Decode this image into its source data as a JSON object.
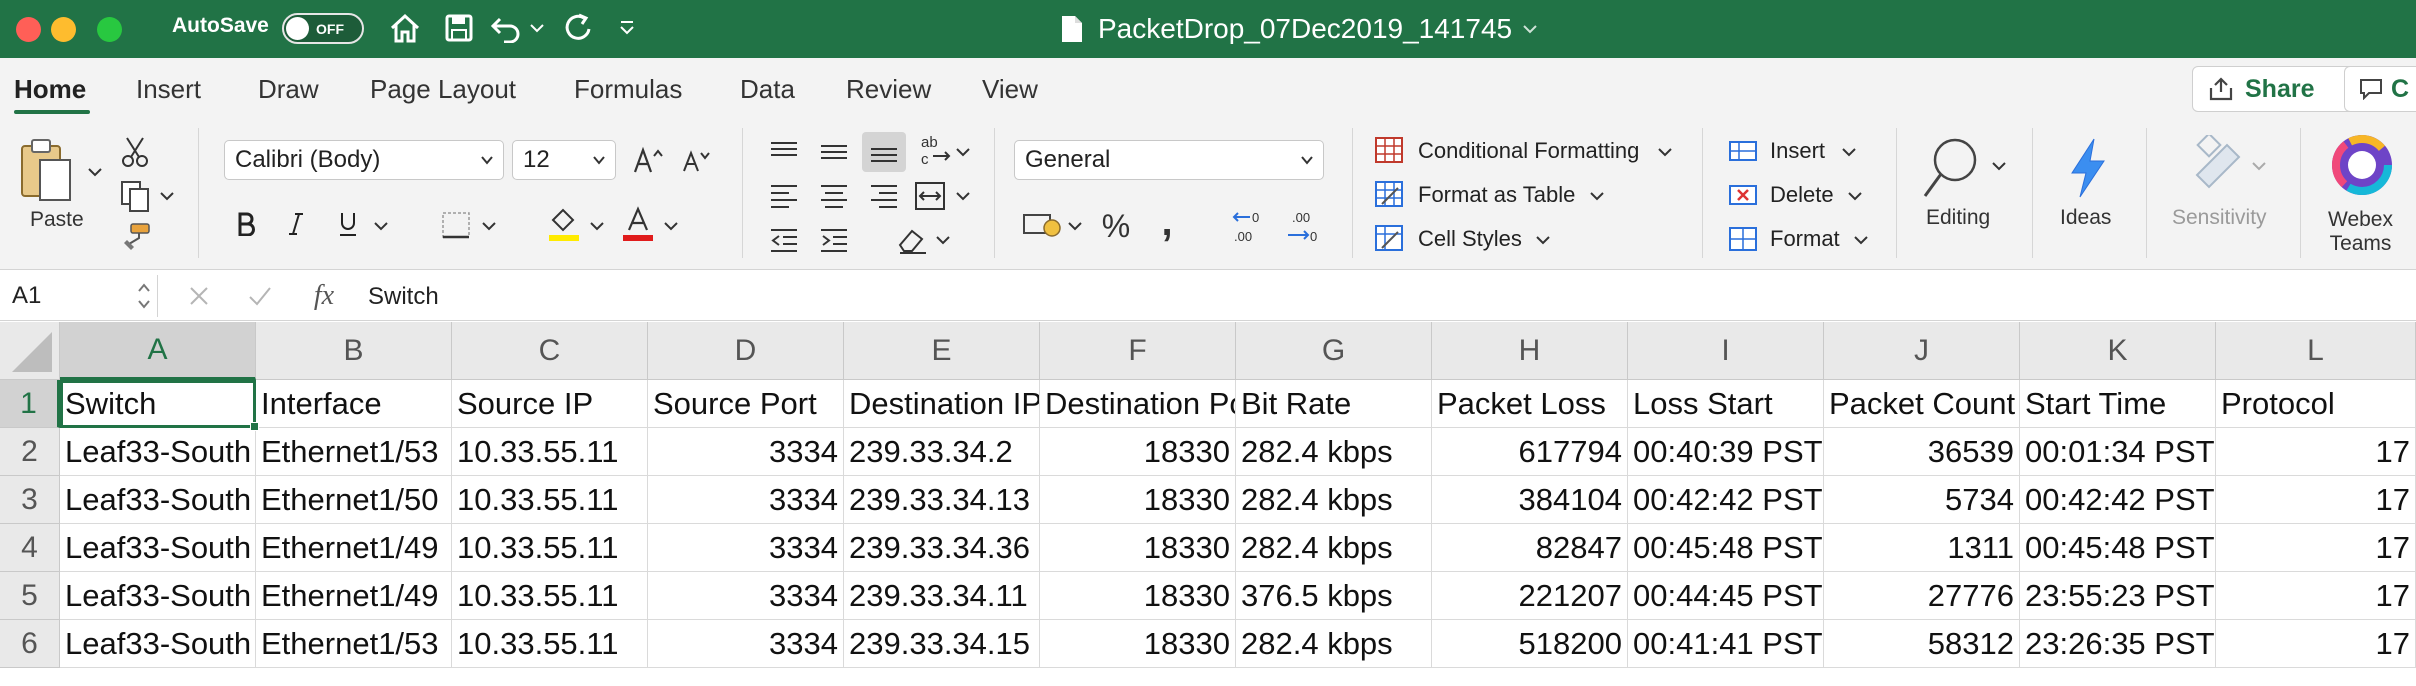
{
  "titlebar": {
    "autosave_label": "AutoSave",
    "toggle_state": "OFF",
    "document_title": "PacketDrop_07Dec2019_141745"
  },
  "tabs": [
    "Home",
    "Insert",
    "Draw",
    "Page Layout",
    "Formulas",
    "Data",
    "Review",
    "View"
  ],
  "share": {
    "label": "Share",
    "partial_label": "C"
  },
  "ribbon": {
    "paste_label": "Paste",
    "font_name": "Calibri (Body)",
    "font_size": "12",
    "number_format": "General",
    "styles": {
      "conditional_formatting": "Conditional Formatting",
      "format_as_table": "Format as Table",
      "cell_styles": "Cell Styles"
    },
    "cells": {
      "insert": "Insert",
      "delete": "Delete",
      "format": "Format"
    },
    "editing_label": "Editing",
    "ideas_label": "Ideas",
    "sensitivity_label": "Sensitivity",
    "webex_line1": "Webex",
    "webex_line2": "Teams",
    "percent_glyph": "%",
    "comma_glyph": ","
  },
  "formula_bar": {
    "name_box": "A1",
    "fx": "fx",
    "value": "Switch"
  },
  "grid": {
    "selected_cell": "A1",
    "columns": [
      "A",
      "B",
      "C",
      "D",
      "E",
      "F",
      "G",
      "H",
      "I",
      "J",
      "K",
      "L"
    ],
    "row_numbers": [
      "1",
      "2",
      "3",
      "4",
      "5",
      "6"
    ],
    "rows": [
      [
        "Switch",
        "Interface",
        "Source IP",
        "Source Port",
        "Destination IP",
        "Destination Port",
        "Bit Rate",
        "Packet Loss",
        "Loss Start",
        "Packet Count",
        "Start Time",
        "Protocol"
      ],
      [
        "Leaf33-South",
        "Ethernet1/53",
        "10.33.55.11",
        "3334",
        "239.33.34.2",
        "18330",
        "282.4 kbps",
        "617794",
        "00:40:39 PST",
        "36539",
        "00:01:34 PST",
        "17"
      ],
      [
        "Leaf33-South",
        "Ethernet1/50",
        "10.33.55.11",
        "3334",
        "239.33.34.13",
        "18330",
        "282.4 kbps",
        "384104",
        "00:42:42 PST",
        "5734",
        "00:42:42 PST",
        "17"
      ],
      [
        "Leaf33-South",
        "Ethernet1/49",
        "10.33.55.11",
        "3334",
        "239.33.34.36",
        "18330",
        "282.4 kbps",
        "82847",
        "00:45:48 PST",
        "1311",
        "00:45:48 PST",
        "17"
      ],
      [
        "Leaf33-South",
        "Ethernet1/49",
        "10.33.55.11",
        "3334",
        "239.33.34.11",
        "18330",
        "376.5 kbps",
        "221207",
        "00:44:45 PST",
        "27776",
        "23:55:23 PST",
        "17"
      ],
      [
        "Leaf33-South",
        "Ethernet1/53",
        "10.33.55.11",
        "3334",
        "239.33.34.15",
        "18330",
        "282.4 kbps",
        "518200",
        "00:41:41 PST",
        "58312",
        "23:26:35 PST",
        "17"
      ]
    ]
  },
  "colors": {
    "titlebar_green": "#217346",
    "ribbon_bg": "#f3f3f3",
    "header_bg": "#e9e9e9"
  }
}
